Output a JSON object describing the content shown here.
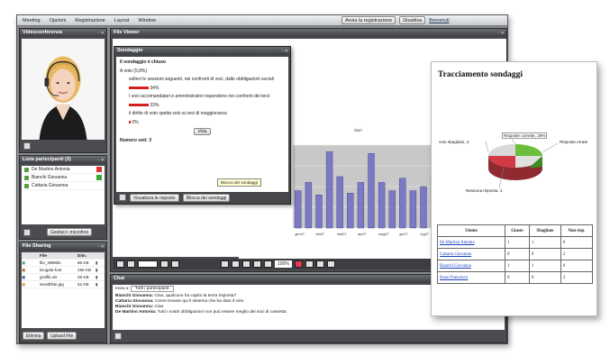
{
  "menu": {
    "items": [
      "Meeting",
      "Opzioni",
      "Registrazione",
      "Layout",
      "Window"
    ],
    "record_button": "Avvia la registrazione",
    "status_button": "Disattiva",
    "user_label": "Benvenuti"
  },
  "webcam": {
    "title": "Videoconferenza"
  },
  "participants": {
    "title": "Lista partecipanti (3)",
    "items": [
      {
        "name": "De Martino Antonia"
      },
      {
        "name": "Bianchi Giovanna"
      },
      {
        "name": "Cattaria Giovanna"
      }
    ],
    "footer_button": "Gestisci i microfoni"
  },
  "file_sharing": {
    "title": "File Sharing",
    "columns": [
      "",
      "File",
      "Dim."
    ],
    "rows": [
      {
        "file": "file_398881",
        "size": "86 KB"
      },
      {
        "file": "brugala-foot",
        "size": "196 KB"
      },
      {
        "file": "graffiti.xls",
        "size": "28 KB"
      },
      {
        "file": "stealthlite.jpg",
        "size": "52 KB"
      }
    ],
    "buttons": [
      "Elimina",
      "Upload File"
    ]
  },
  "viewer": {
    "title": "File Viewer",
    "chart_label": "Sivri",
    "x_labels": [
      "gen07",
      "feb07",
      "mar07",
      "apr07",
      "mag07",
      "giu07",
      "lug07",
      "ago07",
      "set07",
      "ott07"
    ],
    "zoom": "100%"
  },
  "poll": {
    "title": "Sondaggio",
    "heading": "Il sondaggio è chiuso",
    "question_count": "A voto (5,8%)",
    "options": [
      {
        "text": "sollevi le sessioni seguenti, nei confronti di voci, dalle obbligazioni sociali",
        "pct": "34%"
      },
      {
        "text": "I soci accomandatari e amministratori rispondono nei confronti dei terzi",
        "pct": "33%"
      },
      {
        "text": "il diritto di voto spetta solo ai soci di maggioranza",
        "pct": "0%"
      }
    ],
    "vote_button": "Vota",
    "total_label": "Numero voti: 3",
    "tooltip": "Blocca dei sondaggi",
    "footer_buttons": [
      "Visualizza le risposte",
      "Blocca dei sondaggi"
    ]
  },
  "chat": {
    "title": "Chat",
    "to_label": "Invia a:",
    "to_value": "Tutti i partecipanti",
    "messages": [
      {
        "sender": "Bianchi Giovanna:",
        "text": "Ciao, qualcuno ha capito la terza risposta?"
      },
      {
        "sender": "Cattaria Giovanna:",
        "text": "Come trovare qui il sistema che ha dato il voto"
      },
      {
        "sender": "Bianchi Giovanna:",
        "text": "Ciao"
      },
      {
        "sender": "De Martino Antonia:",
        "text": "Tutti i nostri obbligazioni non può essere meglio dei soci di cassetta"
      }
    ]
  },
  "tracking": {
    "title": "Tracciamento sondaggi",
    "pie_labels": [
      "Risposte corrette, 29%",
      "Risposte errate",
      "voto sbagliato, 2",
      "Nessuna risposta, 4"
    ],
    "table_headers": [
      "Utente",
      "Giuste",
      "Sbagliate",
      "Non risp."
    ],
    "rows": [
      {
        "user": "De Martino Antonia",
        "right": "1",
        "wrong": "1",
        "none": "0"
      },
      {
        "user": "Cattaria Giovanna",
        "right": "0",
        "wrong": "0",
        "none": "2"
      },
      {
        "user": "Bianchi Giovanna",
        "right": "1",
        "wrong": "1",
        "none": "0"
      },
      {
        "user": "Rossi Francesco",
        "right": "0",
        "wrong": "0",
        "none": "2"
      }
    ]
  },
  "chart_data": {
    "type": "bar",
    "title": "",
    "categories": [
      "gen07",
      "",
      "feb07",
      "",
      "mar07",
      "",
      "apr07",
      "",
      "mag07",
      "",
      "giu07",
      "",
      "lug07",
      "",
      "ago07",
      "",
      "set07",
      "",
      "ott07",
      ""
    ],
    "values": [
      0.45,
      0.55,
      0.4,
      0.92,
      0.62,
      0.42,
      0.55,
      0.9,
      0.55,
      0.45,
      0.6,
      0.45,
      0.5,
      0.62,
      0.45,
      0.58,
      0.5,
      0.55,
      0.45,
      0.5
    ],
    "ylim": [
      0,
      1
    ],
    "grid": true,
    "series_color": "#7b79c4"
  }
}
